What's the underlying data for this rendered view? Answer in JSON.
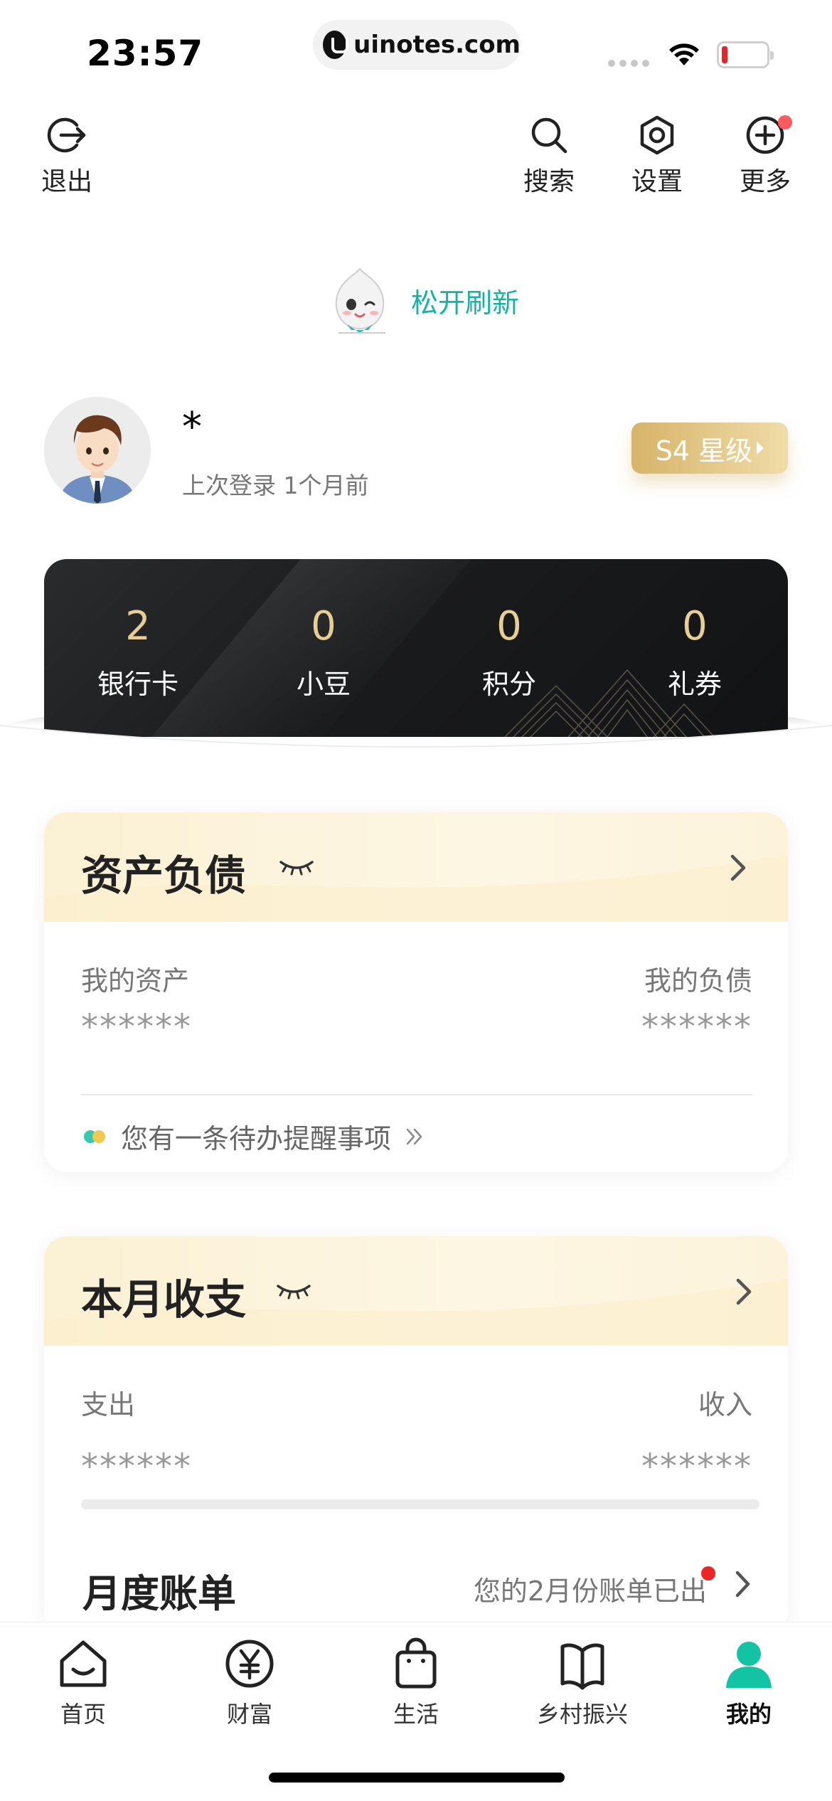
{
  "status_bar": {
    "time": "23:57",
    "url": "uinotes.com"
  },
  "top_bar": {
    "logout_label": "退出",
    "search_label": "搜索",
    "settings_label": "设置",
    "more_label": "更多"
  },
  "refresh": {
    "text": "松开刷新"
  },
  "profile": {
    "username": "*",
    "last_login": "上次登录 1个月前",
    "level": "S4 星级"
  },
  "stats": [
    {
      "value": "2",
      "label": "银行卡"
    },
    {
      "value": "0",
      "label": "小豆"
    },
    {
      "value": "0",
      "label": "积分"
    },
    {
      "value": "0",
      "label": "礼券"
    }
  ],
  "assets_card": {
    "title": "资产负债",
    "assets_label": "我的资产",
    "assets_value": "******",
    "liabilities_label": "我的负债",
    "liabilities_value": "******",
    "reminder": "您有一条待办提醒事项"
  },
  "monthly_card": {
    "title": "本月收支",
    "expense_label": "支出",
    "expense_value": "******",
    "income_label": "收入",
    "income_value": "******",
    "bill_title": "月度账单",
    "bill_status": "您的2月份账单已出"
  },
  "bottom_nav": [
    {
      "label": "首页",
      "icon": "home-icon"
    },
    {
      "label": "财富",
      "icon": "yen-icon"
    },
    {
      "label": "生活",
      "icon": "shopping-bag-icon"
    },
    {
      "label": "乡村振兴",
      "icon": "book-icon"
    },
    {
      "label": "我的",
      "icon": "person-icon",
      "active": true
    }
  ],
  "colors": {
    "accent": "#12b5a5",
    "gold": "#e7cf94",
    "badge": "#d6b46a",
    "alert": "#ef2424"
  }
}
